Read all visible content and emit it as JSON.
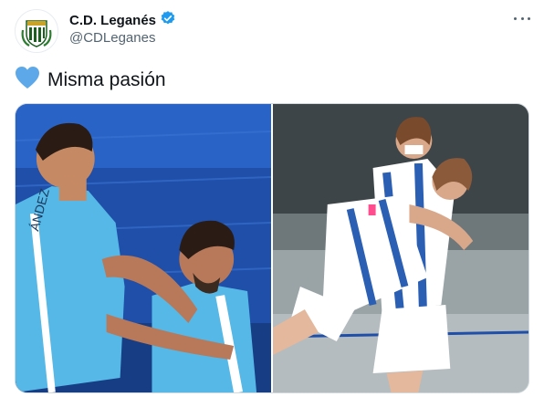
{
  "tweet": {
    "author": {
      "display_name": "C.D. Leganés",
      "handle": "@CDLeganes",
      "verified": true,
      "avatar_icon": "club-crest-icon"
    },
    "text": "Misma pasión",
    "emoji_icon": "blue-heart-icon",
    "menu_icon": "more-options-icon",
    "media": [
      {
        "kind": "photo",
        "icon": "men-players-celebrating-photo"
      },
      {
        "kind": "photo",
        "icon": "women-players-hugging-photo"
      }
    ]
  },
  "colors": {
    "verified_badge": "#1d9bf0",
    "heart": "#5da8e8",
    "kit_light_blue": "#56b8e6",
    "kit_blue_white": "#2b5fb4",
    "stadium_seats": "#1f4fa8"
  }
}
